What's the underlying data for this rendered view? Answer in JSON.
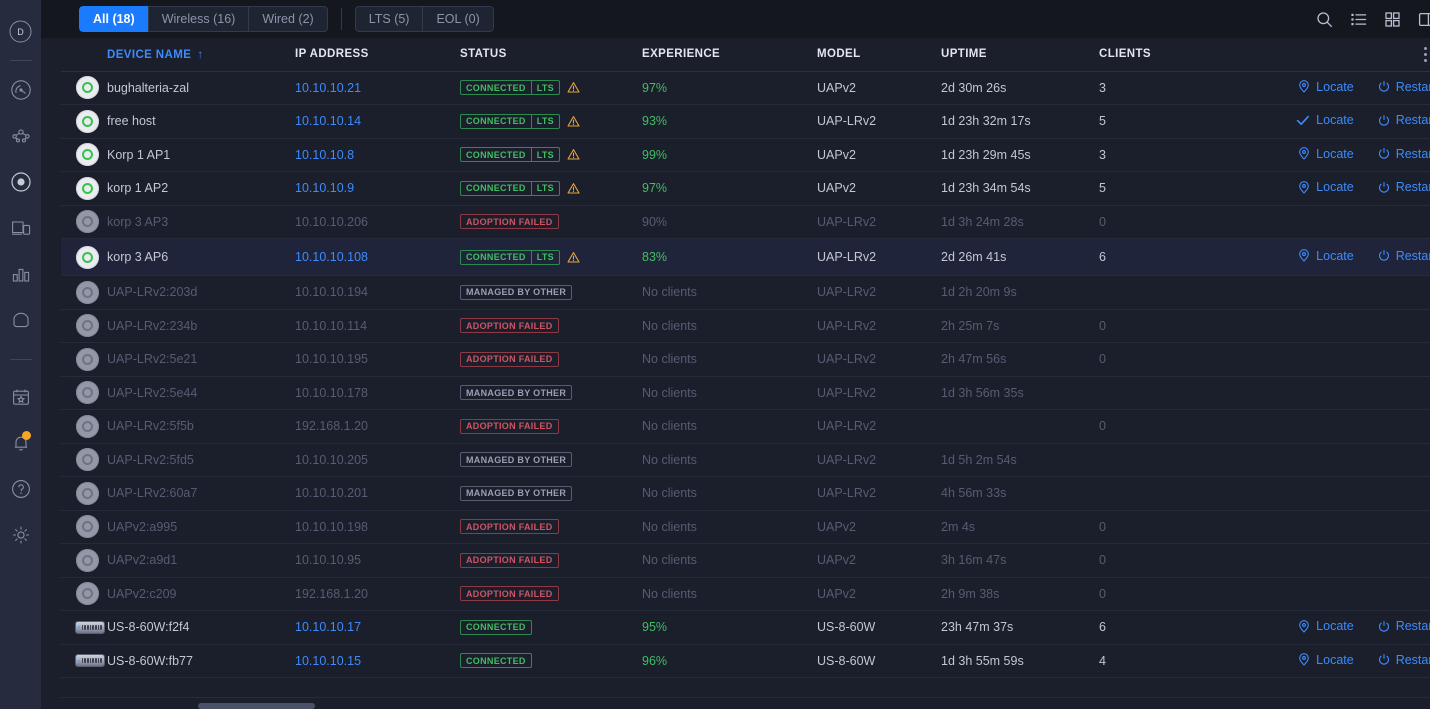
{
  "sidebar": {
    "profile_initial": "D",
    "items": [
      {
        "icon": "profile-avatar",
        "name": "profile"
      },
      {
        "icon": "gauge-icon",
        "name": "dashboard"
      },
      {
        "icon": "topology-icon",
        "name": "topology"
      },
      {
        "icon": "devices-icon",
        "name": "devices"
      },
      {
        "icon": "clients-icon",
        "name": "clients"
      },
      {
        "icon": "statistics-icon",
        "name": "statistics"
      },
      {
        "icon": "shield-icon",
        "name": "protect"
      },
      {
        "icon": "calendar-star-icon",
        "name": "insights"
      },
      {
        "icon": "bell-icon",
        "name": "alerts"
      },
      {
        "icon": "help-icon",
        "name": "help"
      },
      {
        "icon": "gear-icon",
        "name": "settings"
      }
    ]
  },
  "topbar": {
    "tabs_primary": [
      {
        "label": "All (18)",
        "active": true
      },
      {
        "label": "Wireless (16)",
        "active": false
      },
      {
        "label": "Wired (2)",
        "active": false
      }
    ],
    "tabs_secondary": [
      {
        "label": "LTS (5)",
        "active": false
      },
      {
        "label": "EOL (0)",
        "active": false
      }
    ],
    "icons": [
      {
        "name": "search-icon"
      },
      {
        "name": "list-view-icon"
      },
      {
        "name": "grid-view-icon"
      },
      {
        "name": "split-panel-icon"
      }
    ]
  },
  "table": {
    "columns": [
      {
        "key": "device_name",
        "label": "DEVICE NAME",
        "sorted": true,
        "sort_dir": "↑"
      },
      {
        "key": "ip_address",
        "label": "IP ADDRESS"
      },
      {
        "key": "status",
        "label": "STATUS"
      },
      {
        "key": "experience",
        "label": "EXPERIENCE"
      },
      {
        "key": "model",
        "label": "MODEL"
      },
      {
        "key": "uptime",
        "label": "UPTIME"
      },
      {
        "key": "clients",
        "label": "CLIENTS"
      }
    ],
    "menu_icon": "kebab-menu-icon",
    "action_labels": {
      "locate": "Locate",
      "restart": "Restart"
    },
    "rows": [
      {
        "device_icon": "access-point-icon",
        "online": true,
        "dim": false,
        "hovered": false,
        "device_name": "bughalteria-zal",
        "ip_address": "10.10.10.21",
        "ip_link": true,
        "status": "CONNECTED",
        "status_type": "connected",
        "lts": "LTS",
        "warning": true,
        "experience": "97%",
        "exp_state": "on",
        "model": "UAPv2",
        "uptime": "2d 30m 26s",
        "clients": "3",
        "actions": true,
        "locate_icon": "map-pin-icon"
      },
      {
        "device_icon": "access-point-icon",
        "online": true,
        "dim": false,
        "hovered": false,
        "device_name": "free host",
        "ip_address": "10.10.10.14",
        "ip_link": true,
        "status": "CONNECTED",
        "status_type": "connected",
        "lts": "LTS",
        "warning": true,
        "experience": "93%",
        "exp_state": "on",
        "model": "UAP-LRv2",
        "uptime": "1d 23h 32m 17s",
        "clients": "5",
        "actions": true,
        "locate_icon": "check-icon"
      },
      {
        "device_icon": "access-point-icon",
        "online": true,
        "dim": false,
        "hovered": false,
        "device_name": "Korp 1 AP1",
        "ip_address": "10.10.10.8",
        "ip_link": true,
        "status": "CONNECTED",
        "status_type": "connected",
        "lts": "LTS",
        "warning": true,
        "experience": "99%",
        "exp_state": "on",
        "model": "UAPv2",
        "uptime": "1d 23h 29m 45s",
        "clients": "3",
        "actions": true,
        "locate_icon": "map-pin-icon"
      },
      {
        "device_icon": "access-point-icon",
        "online": true,
        "dim": false,
        "hovered": false,
        "device_name": "korp 1 AP2",
        "ip_address": "10.10.10.9",
        "ip_link": true,
        "status": "CONNECTED",
        "status_type": "connected",
        "lts": "LTS",
        "warning": true,
        "experience": "97%",
        "exp_state": "on",
        "model": "UAPv2",
        "uptime": "1d 23h 34m 54s",
        "clients": "5",
        "actions": true,
        "locate_icon": "map-pin-icon"
      },
      {
        "device_icon": "access-point-icon",
        "online": false,
        "dim": true,
        "hovered": false,
        "device_name": "korp 3 AP3",
        "ip_address": "10.10.10.206",
        "ip_link": false,
        "status": "ADOPTION FAILED",
        "status_type": "failed",
        "lts": "",
        "warning": false,
        "experience": "90%",
        "exp_state": "dim",
        "model": "UAP-LRv2",
        "uptime": "1d 3h 24m 28s",
        "clients": "0",
        "actions": false,
        "locate_icon": ""
      },
      {
        "device_icon": "access-point-icon",
        "online": true,
        "dim": false,
        "hovered": true,
        "device_name": "korp 3 AP6",
        "ip_address": "10.10.10.108",
        "ip_link": true,
        "status": "CONNECTED",
        "status_type": "connected",
        "lts": "LTS",
        "warning": true,
        "experience": "83%",
        "exp_state": "on",
        "model": "UAP-LRv2",
        "uptime": "2d 26m 41s",
        "clients": "6",
        "actions": true,
        "locate_icon": "map-pin-icon"
      },
      {
        "device_icon": "access-point-icon",
        "online": false,
        "dim": true,
        "hovered": false,
        "device_name": "UAP-LRv2:203d",
        "ip_address": "10.10.10.194",
        "ip_link": false,
        "status": "MANAGED BY OTHER",
        "status_type": "managed",
        "lts": "",
        "warning": false,
        "experience": "No clients",
        "exp_state": "none",
        "model": "UAP-LRv2",
        "uptime": "1d 2h 20m 9s",
        "clients": "",
        "actions": false,
        "locate_icon": ""
      },
      {
        "device_icon": "access-point-icon",
        "online": false,
        "dim": true,
        "hovered": false,
        "device_name": "UAP-LRv2:234b",
        "ip_address": "10.10.10.114",
        "ip_link": false,
        "status": "ADOPTION FAILED",
        "status_type": "failed",
        "lts": "",
        "warning": false,
        "experience": "No clients",
        "exp_state": "none",
        "model": "UAP-LRv2",
        "uptime": "2h 25m 7s",
        "clients": "0",
        "actions": false,
        "locate_icon": ""
      },
      {
        "device_icon": "access-point-icon",
        "online": false,
        "dim": true,
        "hovered": false,
        "device_name": "UAP-LRv2:5e21",
        "ip_address": "10.10.10.195",
        "ip_link": false,
        "status": "ADOPTION FAILED",
        "status_type": "failed",
        "lts": "",
        "warning": false,
        "experience": "No clients",
        "exp_state": "none",
        "model": "UAP-LRv2",
        "uptime": "2h 47m 56s",
        "clients": "0",
        "actions": false,
        "locate_icon": ""
      },
      {
        "device_icon": "access-point-icon",
        "online": false,
        "dim": true,
        "hovered": false,
        "device_name": "UAP-LRv2:5e44",
        "ip_address": "10.10.10.178",
        "ip_link": false,
        "status": "MANAGED BY OTHER",
        "status_type": "managed",
        "lts": "",
        "warning": false,
        "experience": "No clients",
        "exp_state": "none",
        "model": "UAP-LRv2",
        "uptime": "1d 3h 56m 35s",
        "clients": "",
        "actions": false,
        "locate_icon": ""
      },
      {
        "device_icon": "access-point-icon",
        "online": false,
        "dim": true,
        "hovered": false,
        "device_name": "UAP-LRv2:5f5b",
        "ip_address": "192.168.1.20",
        "ip_link": false,
        "status": "ADOPTION FAILED",
        "status_type": "failed",
        "lts": "",
        "warning": false,
        "experience": "No clients",
        "exp_state": "none",
        "model": "UAP-LRv2",
        "uptime": "",
        "clients": "0",
        "actions": false,
        "locate_icon": ""
      },
      {
        "device_icon": "access-point-icon",
        "online": false,
        "dim": true,
        "hovered": false,
        "device_name": "UAP-LRv2:5fd5",
        "ip_address": "10.10.10.205",
        "ip_link": false,
        "status": "MANAGED BY OTHER",
        "status_type": "managed",
        "lts": "",
        "warning": false,
        "experience": "No clients",
        "exp_state": "none",
        "model": "UAP-LRv2",
        "uptime": "1d 5h 2m 54s",
        "clients": "",
        "actions": false,
        "locate_icon": ""
      },
      {
        "device_icon": "access-point-icon",
        "online": false,
        "dim": true,
        "hovered": false,
        "device_name": "UAP-LRv2:60a7",
        "ip_address": "10.10.10.201",
        "ip_link": false,
        "status": "MANAGED BY OTHER",
        "status_type": "managed",
        "lts": "",
        "warning": false,
        "experience": "No clients",
        "exp_state": "none",
        "model": "UAP-LRv2",
        "uptime": "4h 56m 33s",
        "clients": "",
        "actions": false,
        "locate_icon": ""
      },
      {
        "device_icon": "access-point-icon",
        "online": false,
        "dim": true,
        "hovered": false,
        "device_name": "UAPv2:a995",
        "ip_address": "10.10.10.198",
        "ip_link": false,
        "status": "ADOPTION FAILED",
        "status_type": "failed",
        "lts": "",
        "warning": false,
        "experience": "No clients",
        "exp_state": "none",
        "model": "UAPv2",
        "uptime": "2m 4s",
        "clients": "0",
        "actions": false,
        "locate_icon": ""
      },
      {
        "device_icon": "access-point-icon",
        "online": false,
        "dim": true,
        "hovered": false,
        "device_name": "UAPv2:a9d1",
        "ip_address": "10.10.10.95",
        "ip_link": false,
        "status": "ADOPTION FAILED",
        "status_type": "failed",
        "lts": "",
        "warning": false,
        "experience": "No clients",
        "exp_state": "none",
        "model": "UAPv2",
        "uptime": "3h 16m 47s",
        "clients": "0",
        "actions": false,
        "locate_icon": ""
      },
      {
        "device_icon": "access-point-icon",
        "online": false,
        "dim": true,
        "hovered": false,
        "device_name": "UAPv2:c209",
        "ip_address": "192.168.1.20",
        "ip_link": false,
        "status": "ADOPTION FAILED",
        "status_type": "failed",
        "lts": "",
        "warning": false,
        "experience": "No clients",
        "exp_state": "none",
        "model": "UAPv2",
        "uptime": "2h 9m 38s",
        "clients": "0",
        "actions": false,
        "locate_icon": ""
      },
      {
        "device_icon": "switch-icon",
        "online": true,
        "dim": false,
        "hovered": false,
        "device_name": "US-8-60W:f2f4",
        "ip_address": "10.10.10.17",
        "ip_link": true,
        "status": "CONNECTED",
        "status_type": "connected",
        "lts": "",
        "warning": false,
        "experience": "95%",
        "exp_state": "on",
        "model": "US-8-60W",
        "uptime": "23h 47m 37s",
        "clients": "6",
        "actions": true,
        "locate_icon": "map-pin-icon"
      },
      {
        "device_icon": "switch-icon",
        "online": true,
        "dim": false,
        "hovered": false,
        "device_name": "US-8-60W:fb77",
        "ip_address": "10.10.10.15",
        "ip_link": true,
        "status": "CONNECTED",
        "status_type": "connected",
        "lts": "",
        "warning": false,
        "experience": "96%",
        "exp_state": "on",
        "model": "US-8-60W",
        "uptime": "1d 3h 55m 59s",
        "clients": "4",
        "actions": true,
        "locate_icon": "map-pin-icon"
      }
    ]
  },
  "colors": {
    "accent": "#1a7bff",
    "link": "#3d8bfd",
    "good": "#3fbf62",
    "danger": "#cf5563",
    "warning": "#e8a33d",
    "sidebar_bg": "#262b3d",
    "page_bg": "#1b1e2b",
    "topbar_bg": "#15171f"
  }
}
